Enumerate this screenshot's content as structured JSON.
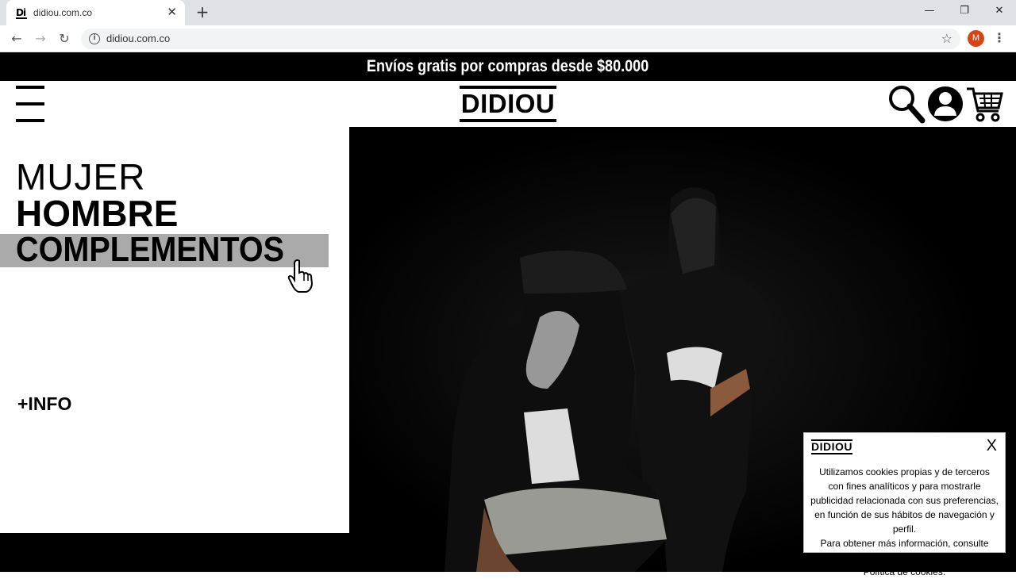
{
  "browser": {
    "tab_title": "didiou.com.co",
    "tab_favicon": "Di",
    "url": "didiou.com.co",
    "profile_initial": "M"
  },
  "promo": {
    "text": "Envíos gratis por compras desde $80.000"
  },
  "header": {
    "logo": "DIDIOU"
  },
  "menu": {
    "categories": [
      "MUJER",
      "HOMBRE",
      "COMPLEMENTOS"
    ],
    "more_info": "+INFO"
  },
  "cookie": {
    "logo": "DIDIOU",
    "close": "X",
    "lines": [
      "Utilizamos cookies propias y de terceros",
      "con fines analíticos y para mostrarle",
      "publicidad relacionada con sus preferencias,",
      "en función de sus hábitos de navegación y perfil.",
      "Para obtener más información, consulte nuestra",
      "Política de cookies."
    ]
  },
  "colors": {
    "promo_bg": "#000000",
    "highlight": "#aaaaaa",
    "avatar": "#d84315"
  }
}
